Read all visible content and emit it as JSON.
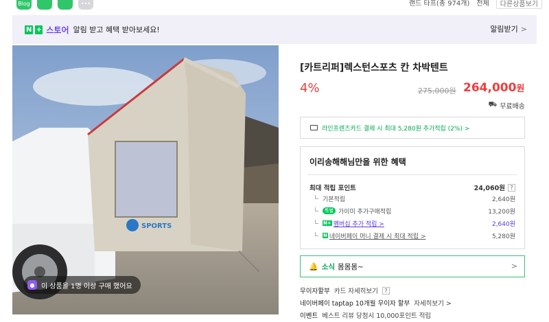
{
  "top_icons": [
    {
      "name": "blog-icon",
      "label": "Blog"
    },
    {
      "name": "cafe-icon",
      "label": ""
    },
    {
      "name": "bookmark-icon",
      "label": ""
    },
    {
      "name": "more-icon",
      "label": "•••"
    }
  ],
  "top_right": {
    "sort": "랜드 타프(총 974개)",
    "filter": "전체",
    "more_products": "다른상품보기"
  },
  "banner": {
    "store_label": "스토어",
    "message": "알림 받고 혜택 받아보세요!",
    "alert_button": "알림받기",
    "chevron": ">"
  },
  "product": {
    "title": "[카트리퍼]렉스턴스포츠 칸 차박텐트",
    "discount": "4%",
    "original_price": "275,000원",
    "sale_price_number": "264,000",
    "sale_price_unit": "원",
    "shipping": "무료배송",
    "purchase_badge": "이 상품을 1명 이상 구매 했어요"
  },
  "card_promo": "라인프렌즈카드 결제 시 최대 5,280원 추가적립 (2%) >",
  "benefits": {
    "title": "이리송해해님만을 위한 혜택",
    "max_points_label": "최대 적립 포인트",
    "max_points_value": "24,060원",
    "rows": [
      {
        "label": "기본적립",
        "value": "2,640원"
      },
      {
        "tag": "특별",
        "label": "가이미 추가구매적립",
        "value": "13,200원"
      },
      {
        "tag": "N+",
        "label": "멤버십 추가 적립 >",
        "value": "2,640원"
      },
      {
        "tag": "N",
        "label": "네이버페이 머니 결제 시 최대 적립 >",
        "value": "5,280원"
      }
    ]
  },
  "news": {
    "label": "소식",
    "text": "몸몸몸~",
    "chevron": ">"
  },
  "installment": {
    "label": "무이자할부",
    "card_detail": "카드 자세히보기",
    "taptap": "네이버페이 taptap 10개월 무이자 할부",
    "taptap_detail": "자세히보기 >",
    "event_label": "이벤트",
    "event_text": "베스트 리뷰 당첨시 10,000포인트 적립"
  },
  "colors": {
    "accent_purple": "#6b47e6",
    "naver_green": "#03c75a",
    "price_red": "#f03c3c"
  }
}
